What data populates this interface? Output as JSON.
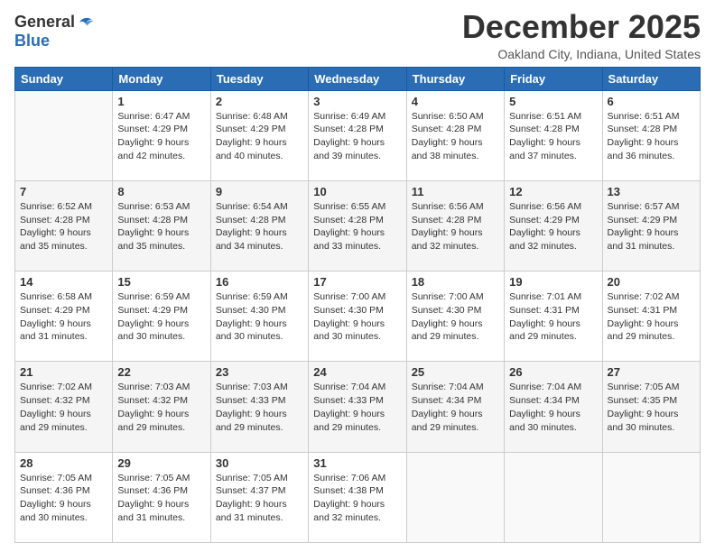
{
  "header": {
    "logo_general": "General",
    "logo_blue": "Blue",
    "month_title": "December 2025",
    "location": "Oakland City, Indiana, United States"
  },
  "days_of_week": [
    "Sunday",
    "Monday",
    "Tuesday",
    "Wednesday",
    "Thursday",
    "Friday",
    "Saturday"
  ],
  "weeks": [
    [
      {
        "day": "",
        "sunrise": "",
        "sunset": "",
        "daylight": "",
        "empty": true
      },
      {
        "day": "1",
        "sunrise": "Sunrise: 6:47 AM",
        "sunset": "Sunset: 4:29 PM",
        "daylight": "Daylight: 9 hours and 42 minutes."
      },
      {
        "day": "2",
        "sunrise": "Sunrise: 6:48 AM",
        "sunset": "Sunset: 4:29 PM",
        "daylight": "Daylight: 9 hours and 40 minutes."
      },
      {
        "day": "3",
        "sunrise": "Sunrise: 6:49 AM",
        "sunset": "Sunset: 4:28 PM",
        "daylight": "Daylight: 9 hours and 39 minutes."
      },
      {
        "day": "4",
        "sunrise": "Sunrise: 6:50 AM",
        "sunset": "Sunset: 4:28 PM",
        "daylight": "Daylight: 9 hours and 38 minutes."
      },
      {
        "day": "5",
        "sunrise": "Sunrise: 6:51 AM",
        "sunset": "Sunset: 4:28 PM",
        "daylight": "Daylight: 9 hours and 37 minutes."
      },
      {
        "day": "6",
        "sunrise": "Sunrise: 6:51 AM",
        "sunset": "Sunset: 4:28 PM",
        "daylight": "Daylight: 9 hours and 36 minutes."
      }
    ],
    [
      {
        "day": "7",
        "sunrise": "Sunrise: 6:52 AM",
        "sunset": "Sunset: 4:28 PM",
        "daylight": "Daylight: 9 hours and 35 minutes."
      },
      {
        "day": "8",
        "sunrise": "Sunrise: 6:53 AM",
        "sunset": "Sunset: 4:28 PM",
        "daylight": "Daylight: 9 hours and 35 minutes."
      },
      {
        "day": "9",
        "sunrise": "Sunrise: 6:54 AM",
        "sunset": "Sunset: 4:28 PM",
        "daylight": "Daylight: 9 hours and 34 minutes."
      },
      {
        "day": "10",
        "sunrise": "Sunrise: 6:55 AM",
        "sunset": "Sunset: 4:28 PM",
        "daylight": "Daylight: 9 hours and 33 minutes."
      },
      {
        "day": "11",
        "sunrise": "Sunrise: 6:56 AM",
        "sunset": "Sunset: 4:28 PM",
        "daylight": "Daylight: 9 hours and 32 minutes."
      },
      {
        "day": "12",
        "sunrise": "Sunrise: 6:56 AM",
        "sunset": "Sunset: 4:29 PM",
        "daylight": "Daylight: 9 hours and 32 minutes."
      },
      {
        "day": "13",
        "sunrise": "Sunrise: 6:57 AM",
        "sunset": "Sunset: 4:29 PM",
        "daylight": "Daylight: 9 hours and 31 minutes."
      }
    ],
    [
      {
        "day": "14",
        "sunrise": "Sunrise: 6:58 AM",
        "sunset": "Sunset: 4:29 PM",
        "daylight": "Daylight: 9 hours and 31 minutes."
      },
      {
        "day": "15",
        "sunrise": "Sunrise: 6:59 AM",
        "sunset": "Sunset: 4:29 PM",
        "daylight": "Daylight: 9 hours and 30 minutes."
      },
      {
        "day": "16",
        "sunrise": "Sunrise: 6:59 AM",
        "sunset": "Sunset: 4:30 PM",
        "daylight": "Daylight: 9 hours and 30 minutes."
      },
      {
        "day": "17",
        "sunrise": "Sunrise: 7:00 AM",
        "sunset": "Sunset: 4:30 PM",
        "daylight": "Daylight: 9 hours and 30 minutes."
      },
      {
        "day": "18",
        "sunrise": "Sunrise: 7:00 AM",
        "sunset": "Sunset: 4:30 PM",
        "daylight": "Daylight: 9 hours and 29 minutes."
      },
      {
        "day": "19",
        "sunrise": "Sunrise: 7:01 AM",
        "sunset": "Sunset: 4:31 PM",
        "daylight": "Daylight: 9 hours and 29 minutes."
      },
      {
        "day": "20",
        "sunrise": "Sunrise: 7:02 AM",
        "sunset": "Sunset: 4:31 PM",
        "daylight": "Daylight: 9 hours and 29 minutes."
      }
    ],
    [
      {
        "day": "21",
        "sunrise": "Sunrise: 7:02 AM",
        "sunset": "Sunset: 4:32 PM",
        "daylight": "Daylight: 9 hours and 29 minutes."
      },
      {
        "day": "22",
        "sunrise": "Sunrise: 7:03 AM",
        "sunset": "Sunset: 4:32 PM",
        "daylight": "Daylight: 9 hours and 29 minutes."
      },
      {
        "day": "23",
        "sunrise": "Sunrise: 7:03 AM",
        "sunset": "Sunset: 4:33 PM",
        "daylight": "Daylight: 9 hours and 29 minutes."
      },
      {
        "day": "24",
        "sunrise": "Sunrise: 7:04 AM",
        "sunset": "Sunset: 4:33 PM",
        "daylight": "Daylight: 9 hours and 29 minutes."
      },
      {
        "day": "25",
        "sunrise": "Sunrise: 7:04 AM",
        "sunset": "Sunset: 4:34 PM",
        "daylight": "Daylight: 9 hours and 29 minutes."
      },
      {
        "day": "26",
        "sunrise": "Sunrise: 7:04 AM",
        "sunset": "Sunset: 4:34 PM",
        "daylight": "Daylight: 9 hours and 30 minutes."
      },
      {
        "day": "27",
        "sunrise": "Sunrise: 7:05 AM",
        "sunset": "Sunset: 4:35 PM",
        "daylight": "Daylight: 9 hours and 30 minutes."
      }
    ],
    [
      {
        "day": "28",
        "sunrise": "Sunrise: 7:05 AM",
        "sunset": "Sunset: 4:36 PM",
        "daylight": "Daylight: 9 hours and 30 minutes."
      },
      {
        "day": "29",
        "sunrise": "Sunrise: 7:05 AM",
        "sunset": "Sunset: 4:36 PM",
        "daylight": "Daylight: 9 hours and 31 minutes."
      },
      {
        "day": "30",
        "sunrise": "Sunrise: 7:05 AM",
        "sunset": "Sunset: 4:37 PM",
        "daylight": "Daylight: 9 hours and 31 minutes."
      },
      {
        "day": "31",
        "sunrise": "Sunrise: 7:06 AM",
        "sunset": "Sunset: 4:38 PM",
        "daylight": "Daylight: 9 hours and 32 minutes."
      },
      {
        "day": "",
        "sunrise": "",
        "sunset": "",
        "daylight": "",
        "empty": true
      },
      {
        "day": "",
        "sunrise": "",
        "sunset": "",
        "daylight": "",
        "empty": true
      },
      {
        "day": "",
        "sunrise": "",
        "sunset": "",
        "daylight": "",
        "empty": true
      }
    ]
  ]
}
